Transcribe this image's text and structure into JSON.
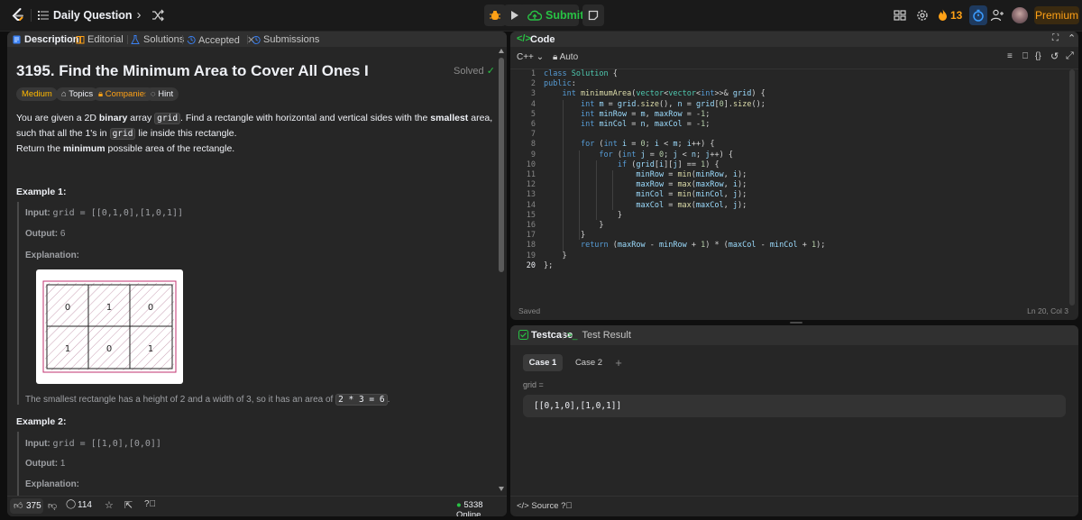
{
  "topbar": {
    "title": "Daily Question",
    "submit_label": "Submit",
    "streak_count": "13",
    "premium_label": "Premium",
    "icons": [
      "leetcode-logo",
      "list-icon",
      "chevron-left-icon",
      "chevron-right-icon",
      "shuffle-icon",
      "debug-icon",
      "run-icon",
      "upload-icon",
      "notes-icon",
      "layout-icon",
      "settings-icon",
      "fire-icon",
      "timer-icon",
      "add-friend-icon",
      "avatar"
    ]
  },
  "left_tabs": [
    {
      "label": "Description"
    },
    {
      "label": "Editorial"
    },
    {
      "label": "Solutions"
    },
    {
      "label": "Accepted"
    },
    {
      "label": "Submissions"
    }
  ],
  "problem": {
    "title": "3195. Find the Minimum Area to Cover All Ones I",
    "status": "Solved",
    "tags": [
      "Medium",
      "Topics",
      "Companies",
      "Hint"
    ],
    "desc_1": "You are given a 2D",
    "desc_bold_1": "binary",
    "desc_2": "array",
    "desc_code_1": "grid",
    "desc_3": ". Find a rectangle with horizontal and vertical sides with the",
    "desc_bold_2": "smallest",
    "desc_4": "area, such that all the 1's in",
    "desc_code_2": "grid",
    "desc_5": "lie inside this rectangle.",
    "return_1": "Return the",
    "return_bold": "minimum",
    "return_2": "possible area of the rectangle.",
    "example1": {
      "title": "Example 1:",
      "input_label": "Input:",
      "input_text": "grid = [[0,1,0],[1,0,1]]",
      "output_label": "Output:",
      "output_value": "6",
      "explanation_label": "Explanation:",
      "explanation_text": "The smallest rectangle has a height of 2 and a width of 3, so it has an area of",
      "explanation_code": "2 * 3 = 6",
      "explanation_end": "."
    },
    "grid_cells": [
      "0",
      "1",
      "0",
      "1",
      "0",
      "1"
    ],
    "example2": {
      "title": "Example 2:",
      "input_label": "Input:",
      "input_text": "grid = [[1,0],[0,0]]",
      "output_label": "Output:",
      "output_value": "1",
      "explanation_label": "Explanation:"
    }
  },
  "left_footer": {
    "likes": "375",
    "comments": "114",
    "online": "5338 Online"
  },
  "code_panel": {
    "title": "Code",
    "language": "C++",
    "mode": "Auto",
    "saved": "Saved",
    "cursor": "Ln 20, Col 3",
    "line_numbers": [
      "1",
      "2",
      "3",
      "4",
      "5",
      "6",
      "7",
      "8",
      "9",
      "10",
      "11",
      "12",
      "13",
      "14",
      "15",
      "16",
      "17",
      "18",
      "19",
      "20"
    ],
    "lines": [
      "class Solution {",
      "public:",
      "    int minimumArea(vector<vector<int>>& grid) {",
      "        int m = grid.size(), n = grid[0].size();",
      "        int minRow = m, maxRow = -1;",
      "        int minCol = n, maxCol = -1;",
      "",
      "        for (int i = 0; i < m; i++) {",
      "            for (int j = 0; j < n; j++) {",
      "                if (grid[i][j] == 1) {",
      "                    minRow = min(minRow, i);",
      "                    maxRow = max(maxRow, i);",
      "                    minCol = min(minCol, j);",
      "                    maxCol = max(maxCol, j);",
      "                }",
      "            }",
      "        }",
      "        return (maxRow - minRow + 1) * (maxCol - minCol + 1);",
      "    }",
      "};"
    ]
  },
  "test_panel": {
    "tab_testcase": "Testcase",
    "tab_result": "Test Result",
    "case1": "Case 1",
    "case2": "Case 2",
    "add": "+",
    "param_label": "grid =",
    "param_value": "[[0,1,0],[1,0,1]]",
    "source_label": "Source"
  },
  "colors": {
    "accent_green": "#28c244",
    "accent_orange": "#ffa116",
    "medium_yellow": "#ffb800",
    "bg": "#0f0f0f",
    "panel": "#262626"
  }
}
